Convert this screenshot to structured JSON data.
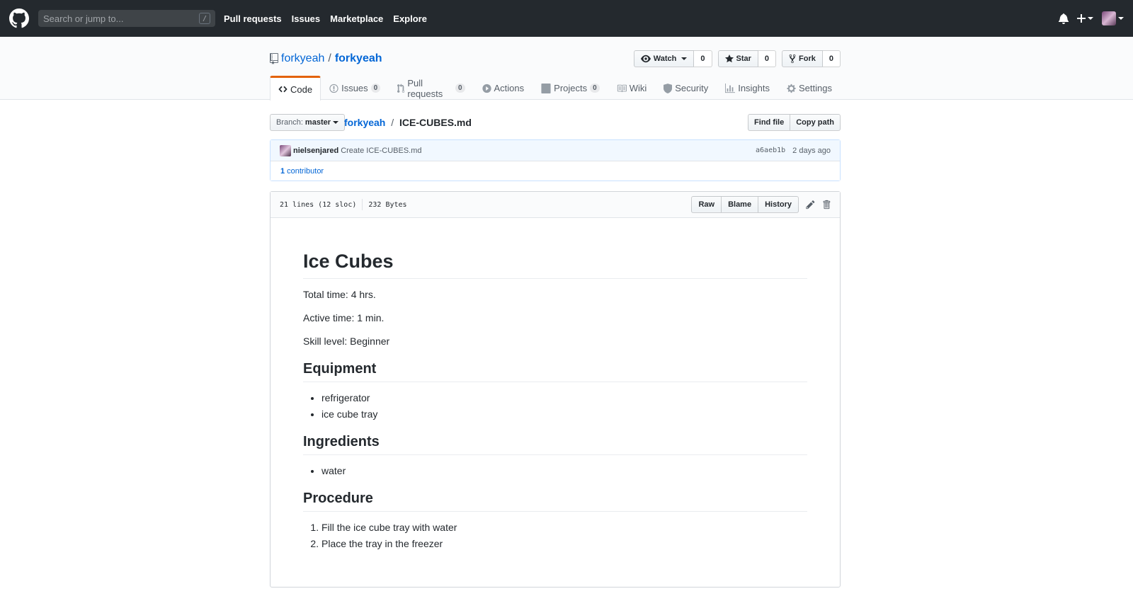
{
  "header": {
    "search_placeholder": "Search or jump to...",
    "search_key": "/",
    "nav": [
      "Pull requests",
      "Issues",
      "Marketplace",
      "Explore"
    ]
  },
  "repo": {
    "owner": "forkyeah",
    "name": "forkyeah",
    "watch_label": "Watch",
    "watch_count": "0",
    "star_label": "Star",
    "star_count": "0",
    "fork_label": "Fork",
    "fork_count": "0",
    "tabs": [
      {
        "label": "Code"
      },
      {
        "label": "Issues",
        "count": "0"
      },
      {
        "label": "Pull requests",
        "count": "0"
      },
      {
        "label": "Actions"
      },
      {
        "label": "Projects",
        "count": "0"
      },
      {
        "label": "Wiki"
      },
      {
        "label": "Security"
      },
      {
        "label": "Insights"
      },
      {
        "label": "Settings"
      }
    ]
  },
  "file_nav": {
    "branch_prefix": "Branch:",
    "branch": "master",
    "repo_link": "forkyeah",
    "file_name": "ICE-CUBES.md",
    "find_file": "Find file",
    "copy_path": "Copy path"
  },
  "commit": {
    "author": "nielsenjared",
    "message": "Create ICE-CUBES.md",
    "sha": "a6aeb1b",
    "when": "2 days ago",
    "contributors_count": "1",
    "contributors_label": "contributor"
  },
  "file": {
    "lines": "21 lines (12 sloc)",
    "size": "232 Bytes",
    "raw": "Raw",
    "blame": "Blame",
    "history": "History"
  },
  "content": {
    "title": "Ice Cubes",
    "total_time": "Total time: 4 hrs.",
    "active_time": "Active time: 1 min.",
    "skill_level": "Skill level: Beginner",
    "equipment_heading": "Equipment",
    "equipment": [
      "refrigerator",
      "ice cube tray"
    ],
    "ingredients_heading": "Ingredients",
    "ingredients": [
      "water"
    ],
    "procedure_heading": "Procedure",
    "procedure": [
      "Fill the ice cube tray with water",
      "Place the tray in the freezer"
    ]
  }
}
